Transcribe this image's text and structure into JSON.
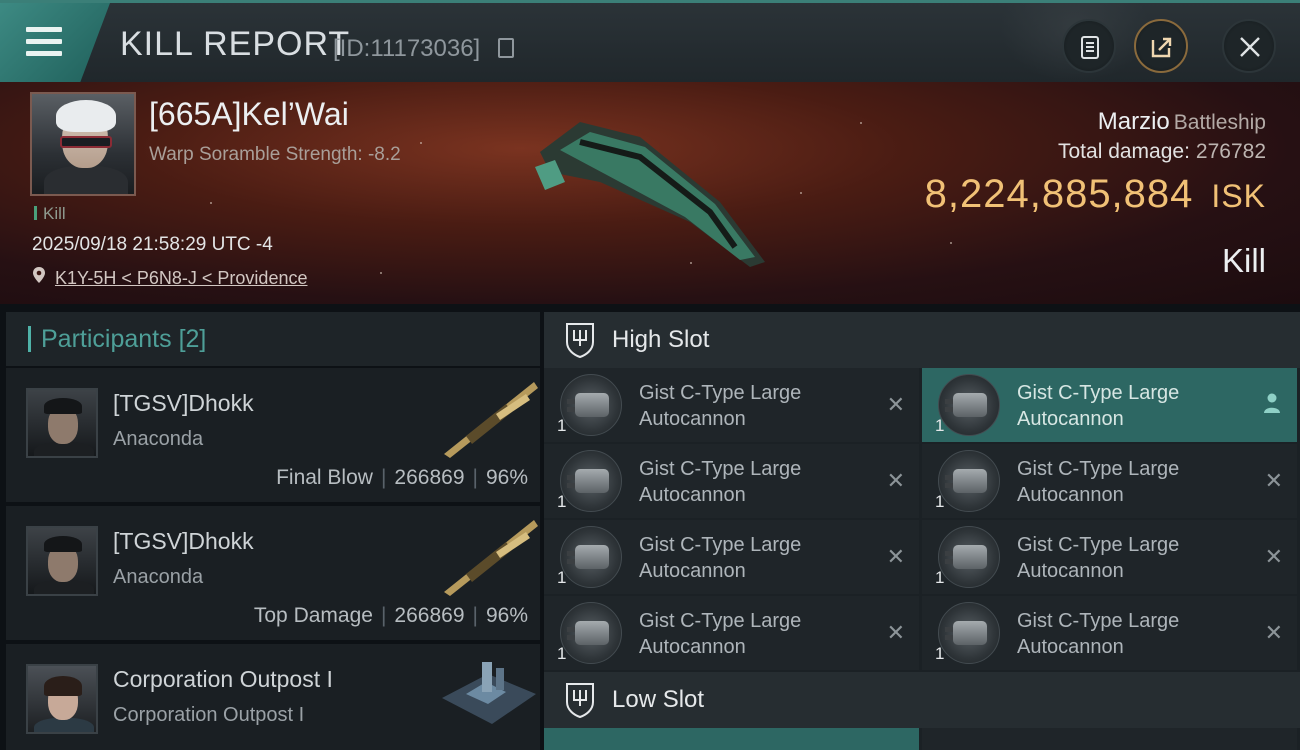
{
  "header": {
    "title": "KILL REPORT",
    "report_id": "[ID:11173036]"
  },
  "victim": {
    "name": "[665A]Kel’Wai",
    "scramble": "Warp Soramble Strength: -8.2",
    "kill_tag": "Kill",
    "datetime": "2025/09/18 21:58:29 UTC -4",
    "location": "K1Y-5H < P6N8-J < Providence",
    "ship_name": "Marzio",
    "ship_class": "Battleship",
    "total_damage_label": "Total damage:",
    "total_damage": "276782",
    "isk_value": "8,224,885,884",
    "isk_currency": "ISK",
    "result": "Kill"
  },
  "participants": {
    "label": "Participants",
    "count": "[2]",
    "rows": [
      {
        "name": "[TGSV]Dhokk",
        "ship": "Anaconda",
        "role": "Final Blow",
        "damage": "266869",
        "percent": "96%"
      },
      {
        "name": "[TGSV]Dhokk",
        "ship": "Anaconda",
        "role": "Top Damage",
        "damage": "266869",
        "percent": "96%"
      },
      {
        "name": "Corporation Outpost I",
        "ship": "Corporation Outpost I"
      }
    ]
  },
  "slots": {
    "high_slot_label": "High Slot",
    "low_slot_label": "Low Slot",
    "high_items": [
      {
        "qty": "1",
        "line1": "Gist C-Type Large",
        "line2": "Autocannon",
        "state": "destroyed"
      },
      {
        "qty": "1",
        "line1": "Gist C-Type Large",
        "line2": "Autocannon",
        "state": "dropped"
      },
      {
        "qty": "1",
        "line1": "Gist C-Type Large",
        "line2": "Autocannon",
        "state": "destroyed"
      },
      {
        "qty": "1",
        "line1": "Gist C-Type Large",
        "line2": "Autocannon",
        "state": "destroyed"
      },
      {
        "qty": "1",
        "line1": "Gist C-Type Large",
        "line2": "Autocannon",
        "state": "destroyed"
      },
      {
        "qty": "1",
        "line1": "Gist C-Type Large",
        "line2": "Autocannon",
        "state": "destroyed"
      },
      {
        "qty": "1",
        "line1": "Gist C-Type Large",
        "line2": "Autocannon",
        "state": "destroyed"
      },
      {
        "qty": "1",
        "line1": "Gist C-Type Large",
        "line2": "Autocannon",
        "state": "destroyed"
      }
    ]
  },
  "icons": {
    "menu": "hamburger-icon",
    "copy": "copy-icon",
    "clipboard": "clipboard-icon",
    "share": "share-icon",
    "close": "close-icon",
    "location": "location-pin-icon",
    "destroyed": "x-icon",
    "dropped": "person-icon"
  },
  "colors": {
    "accent": "#3d8a83",
    "isk": "#f1c176",
    "selected_item": "#2d6763"
  }
}
